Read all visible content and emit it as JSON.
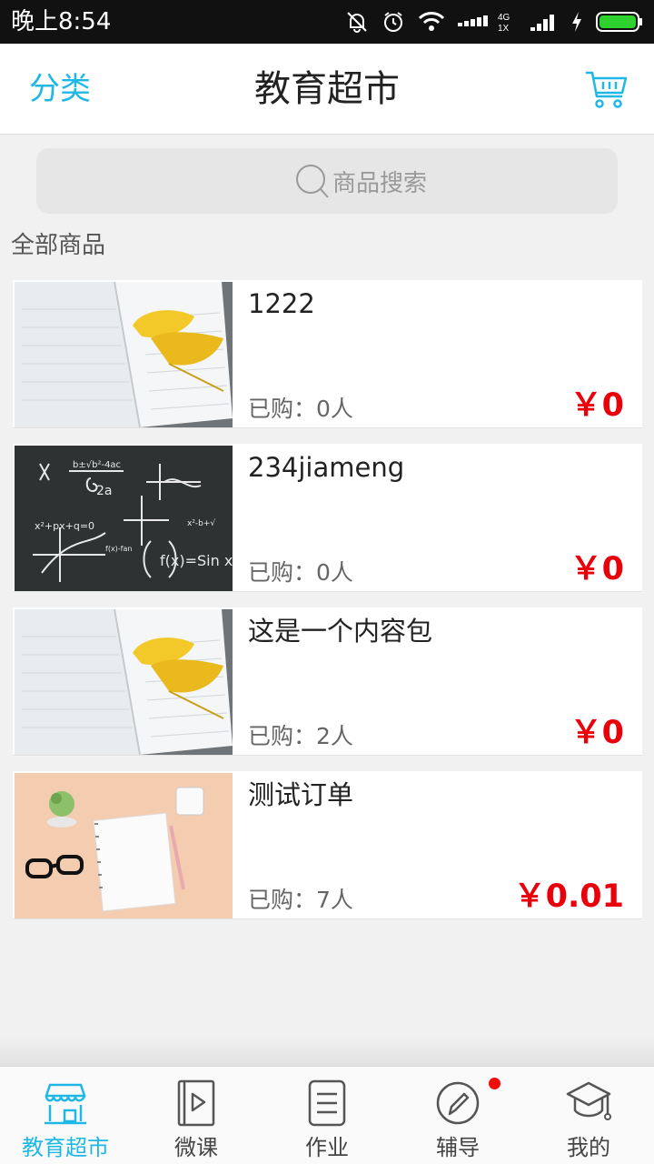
{
  "status_bar": {
    "time": "晚上8:54",
    "network": "4G",
    "network_sub": "1X"
  },
  "header": {
    "category_label": "分类",
    "title": "教育超市",
    "cart_icon": "cart-icon"
  },
  "search": {
    "placeholder": "商品搜索",
    "icon": "search-icon"
  },
  "section_label": "全部商品",
  "products": [
    {
      "name": "1222",
      "sold": "已购：0人",
      "price": "￥0",
      "image": "notebook-ginkgo"
    },
    {
      "name": "234jiameng",
      "sold": "已购：0人",
      "price": "￥0",
      "image": "chalkboard-formulas"
    },
    {
      "name": "这是一个内容包",
      "sold": "已购：2人",
      "price": "￥0",
      "image": "notebook-ginkgo"
    },
    {
      "name": "测试订单",
      "sold": "已购：7人",
      "price": "￥0.01",
      "image": "desk-notepad-glasses"
    }
  ],
  "bottom_nav": [
    {
      "label": "教育超市",
      "icon": "store-icon",
      "active": true
    },
    {
      "label": "微课",
      "icon": "video-book-icon",
      "active": false
    },
    {
      "label": "作业",
      "icon": "document-icon",
      "active": false
    },
    {
      "label": "辅导",
      "icon": "pencil-icon",
      "active": false,
      "badge": true
    },
    {
      "label": "我的",
      "icon": "graduation-cap-icon",
      "active": false
    }
  ],
  "colors": {
    "accent": "#1fb8e6",
    "price": "#e8000b",
    "badge": "#f20d0d"
  }
}
